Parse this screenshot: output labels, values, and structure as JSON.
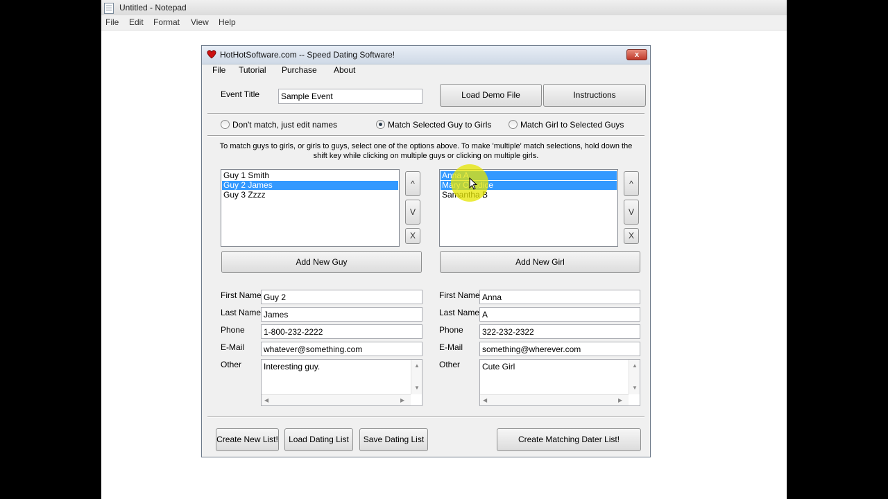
{
  "notepad": {
    "title": "Untitled - Notepad",
    "menu": [
      "File",
      "Edit",
      "Format",
      "View",
      "Help"
    ]
  },
  "app": {
    "title": "HotHotSoftware.com -- Speed Dating Software!",
    "close_label": "x",
    "menu": [
      "File",
      "Tutorial",
      "Purchase",
      "About"
    ],
    "event_title_label": "Event Title",
    "event_title_value": "Sample Event",
    "load_demo_label": "Load Demo File",
    "instructions_label": "Instructions",
    "radios": [
      {
        "label": "Don't match, just edit names",
        "checked": false
      },
      {
        "label": "Match Selected Guy to Girls",
        "checked": true
      },
      {
        "label": "Match Girl to Selected Guys",
        "checked": false
      }
    ],
    "instructions_text_line1": "To match guys to girls, or girls to guys, select one of the options above. To make 'multiple' match selections, hold down the",
    "instructions_text_line2": "shift key while clicking on multiple guys or clicking on multiple girls.",
    "guys": [
      "Guy 1 Smith",
      "Guy 2 James",
      "Guy 3 Zzzz"
    ],
    "guys_selected": [
      false,
      true,
      false
    ],
    "girls": [
      "Anna A",
      "Mary Candice",
      "Samantha B"
    ],
    "girls_selected": [
      true,
      true,
      false
    ],
    "move_up_label": "^",
    "move_down_label": "V",
    "delete_label": "X",
    "add_guy_label": "Add New Guy",
    "add_girl_label": "Add New Girl",
    "field_labels": {
      "first": "First Name",
      "last": "Last Name",
      "phone": "Phone",
      "email": "E-Mail",
      "other": "Other"
    },
    "guy": {
      "first": "Guy 2",
      "last": "James",
      "phone": "1-800-232-2222",
      "email": "whatever@something.com",
      "other": "Interesting guy."
    },
    "girl": {
      "first": "Anna",
      "last": "A",
      "phone": "322-232-2322",
      "email": "something@wherever.com",
      "other": "Cute Girl"
    },
    "create_new_list_label": "Create New List!",
    "load_list_label": "Load Dating List",
    "save_list_label": "Save Dating List",
    "create_matching_label": "Create Matching Dater List!"
  }
}
